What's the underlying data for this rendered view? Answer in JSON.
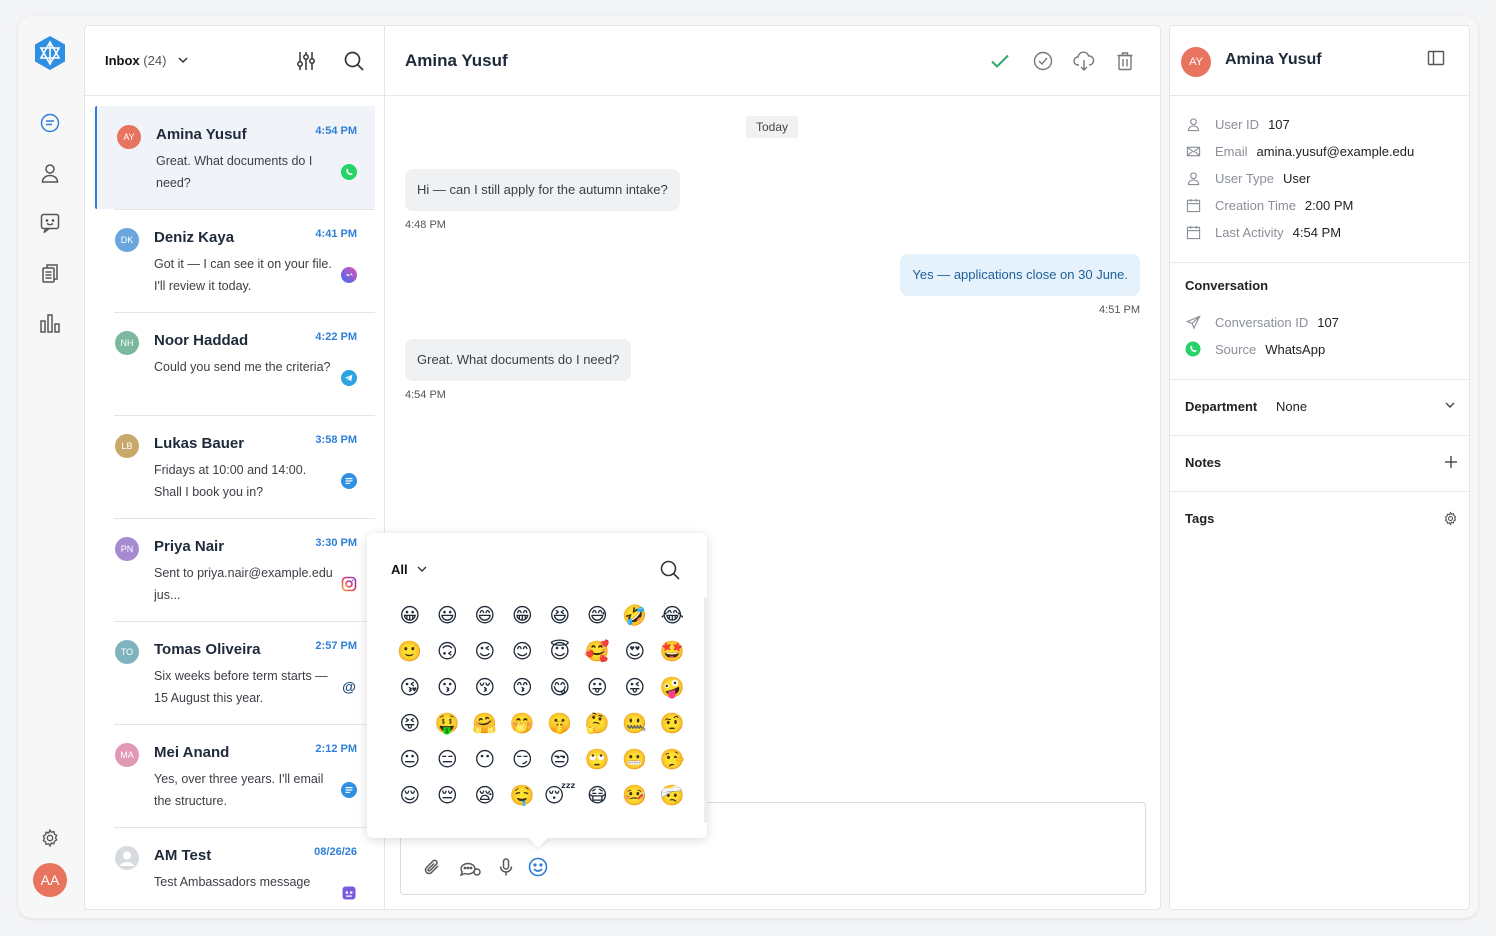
{
  "colors": {
    "accent": "#2f7fd6",
    "whatsapp": "#25d366",
    "avatar_me": "#e8735f"
  },
  "rail": {
    "logo_icon": "hexagon-star-logo",
    "items": [
      {
        "icon": "chat-icon"
      },
      {
        "icon": "user-icon"
      },
      {
        "icon": "feedback-icon"
      },
      {
        "icon": "documents-icon"
      },
      {
        "icon": "bar-chart-icon"
      }
    ],
    "settings_icon": "gear-icon",
    "user_initials": "AA"
  },
  "list": {
    "inbox_label": "Inbox",
    "inbox_count": "(24)",
    "conversations": [
      {
        "initials": "AY",
        "color": "#e8735f",
        "name": "Amina Yusuf",
        "time": "4:54 PM",
        "message": "Great. What documents do I need?",
        "channel": "whatsapp",
        "active": true
      },
      {
        "initials": "DK",
        "color": "#6aa5dc",
        "name": "Deniz Kaya",
        "time": "4:41 PM",
        "message": "Got it — I can see it on your file. I'll review it today.",
        "channel": "messenger"
      },
      {
        "initials": "NH",
        "color": "#7ab8a0",
        "name": "Noor Haddad",
        "time": "4:22 PM",
        "message": "Could you send me the criteria?",
        "channel": "telegram"
      },
      {
        "initials": "LB",
        "color": "#c9a86b",
        "name": "Lukas Bauer",
        "time": "3:58 PM",
        "message": "Fridays at 10:00 and 14:00. Shall I book you in?",
        "channel": "sms"
      },
      {
        "initials": "PN",
        "color": "#a78bd0",
        "name": "Priya Nair",
        "time": "3:30 PM",
        "message": "Sent to priya.nair@example.edu jus...",
        "channel": "instagram"
      },
      {
        "initials": "TO",
        "color": "#7fb3c0",
        "name": "Tomas Oliveira",
        "time": "2:57 PM",
        "message": "Six weeks before term starts — 15 August this year.",
        "channel": "email"
      },
      {
        "initials": "MA",
        "color": "#e098b5",
        "name": "Mei Anand",
        "time": "2:12 PM",
        "message": "Yes, over three years. I'll email the structure.",
        "channel": "sms"
      },
      {
        "initials": "",
        "color": "#cfd3d8",
        "name": "AM Test",
        "time": "08/26/26",
        "message": "Test Ambassadors message",
        "channel": "bot"
      }
    ]
  },
  "chat": {
    "title": "Amina Yusuf",
    "day": "Today",
    "messages": [
      {
        "dir": "in",
        "text": "Hi — can I still apply for the autumn intake?",
        "time": "4:48 PM"
      },
      {
        "dir": "out",
        "text": "Yes — applications close on 30 June.",
        "time": "4:51 PM"
      },
      {
        "dir": "in",
        "text": "Great. What documents do I need?",
        "time": "4:54 PM"
      }
    ],
    "header_icons": [
      "check-icon",
      "check-circle-icon",
      "cloud-download-icon",
      "trash-icon"
    ],
    "composer_icons": [
      "paperclip-icon",
      "chat-bubbles-icon",
      "microphone-icon",
      "emoji-icon"
    ]
  },
  "emoji_picker": {
    "category": "All",
    "emojis": [
      "😀",
      "😃",
      "😄",
      "😁",
      "😆",
      "😅",
      "🤣",
      "😂",
      "🙂",
      "🙃",
      "😉",
      "😊",
      "😇",
      "🥰",
      "😍",
      "🤩",
      "😘",
      "😗",
      "😚",
      "😙",
      "😋",
      "😛",
      "😜",
      "🤪",
      "😝",
      "🤑",
      "🤗",
      "🤭",
      "🤫",
      "🤔",
      "🤐",
      "🤨",
      "😐",
      "😑",
      "😶",
      "😏",
      "😒",
      "🙄",
      "😬",
      "🤥",
      "😌",
      "😔",
      "😪",
      "🤤",
      "😴",
      "😷",
      "🤒",
      "🤕"
    ]
  },
  "info": {
    "initials": "AY",
    "name": "Amina Yusuf",
    "user": [
      {
        "icon": "user-icon",
        "label": "User ID",
        "value": "107"
      },
      {
        "icon": "mail-icon",
        "label": "Email",
        "value": "amina.yusuf@example.edu"
      },
      {
        "icon": "user-icon",
        "label": "User Type",
        "value": "User"
      },
      {
        "icon": "calendar-icon",
        "label": "Creation Time",
        "value": "2:00 PM"
      },
      {
        "icon": "calendar-icon",
        "label": "Last Activity",
        "value": "4:54 PM"
      }
    ],
    "conversation_title": "Conversation",
    "conversation": [
      {
        "icon": "send-icon",
        "label": "Conversation ID",
        "value": "107"
      },
      {
        "icon": "whatsapp-icon",
        "label": "Source",
        "value": "WhatsApp"
      }
    ],
    "department_label": "Department",
    "department_value": "None",
    "notes_label": "Notes",
    "tags_label": "Tags"
  }
}
